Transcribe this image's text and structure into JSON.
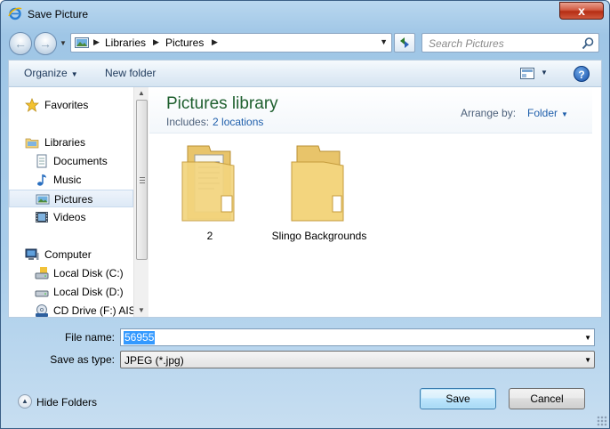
{
  "window": {
    "title": "Save Picture",
    "close_symbol": "x"
  },
  "address_bar": {
    "crumbs": [
      "Libraries",
      "Pictures"
    ],
    "search_placeholder": "Search Pictures"
  },
  "toolbar": {
    "organize": "Organize",
    "new_folder": "New folder"
  },
  "nav_pane": {
    "items": [
      {
        "label": "Favorites",
        "icon": "star-icon"
      },
      {
        "label": "Libraries",
        "icon": "libraries-icon"
      },
      {
        "label": "Documents",
        "icon": "documents-icon"
      },
      {
        "label": "Music",
        "icon": "music-icon"
      },
      {
        "label": "Pictures",
        "icon": "pictures-icon",
        "selected": true
      },
      {
        "label": "Videos",
        "icon": "videos-icon"
      },
      {
        "label": "Computer",
        "icon": "computer-icon"
      },
      {
        "label": "Local Disk (C:)",
        "icon": "drive-icon"
      },
      {
        "label": "Local Disk (D:)",
        "icon": "drive-icon"
      },
      {
        "label": "CD Drive (F:) AIS",
        "icon": "cd-drive-icon"
      }
    ]
  },
  "library": {
    "title": "Pictures library",
    "includes_label": "Includes:",
    "includes_link": "2 locations",
    "arrange_label": "Arrange by:",
    "arrange_value": "Folder"
  },
  "folders": [
    {
      "name": "2"
    },
    {
      "name": "Slingo Backgrounds"
    }
  ],
  "form": {
    "file_name_label": "File name:",
    "file_name_value": "56955",
    "save_type_label": "Save as type:",
    "save_type_value": "JPEG (*.jpg)"
  },
  "footer": {
    "hide_folders": "Hide Folders",
    "save_button": "Save",
    "cancel_button": "Cancel"
  }
}
